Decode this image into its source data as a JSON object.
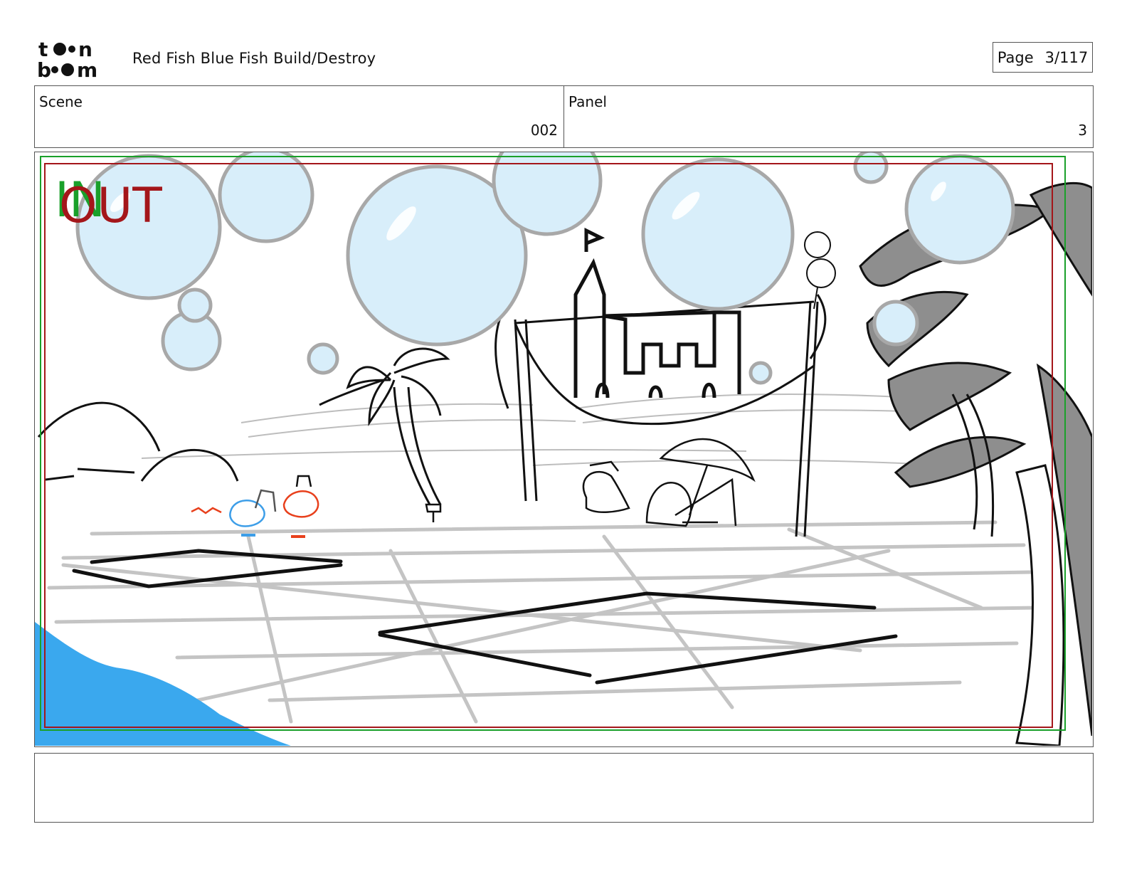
{
  "header": {
    "logo_text": "toon boom",
    "title": "Red Fish Blue Fish  Build/Destroy",
    "page_label": "Page",
    "page_value": "3/117"
  },
  "info": {
    "scene_label": "Scene",
    "scene_value": "002",
    "panel_label": "Panel",
    "panel_value": "3"
  },
  "panel": {
    "in_label": "IN",
    "out_label": "OUT",
    "colors": {
      "in_frame": "#1aa02a",
      "out_frame": "#a4161a",
      "bubble_fill": "#d8eefa",
      "bubble_stroke": "#a8a8a8",
      "water": "#3aa8ee",
      "palm_fill": "#8e8e8e",
      "red_fish": "#e8401c",
      "blue_fish": "#3d9ee8"
    }
  },
  "notes": {
    "text": ""
  }
}
